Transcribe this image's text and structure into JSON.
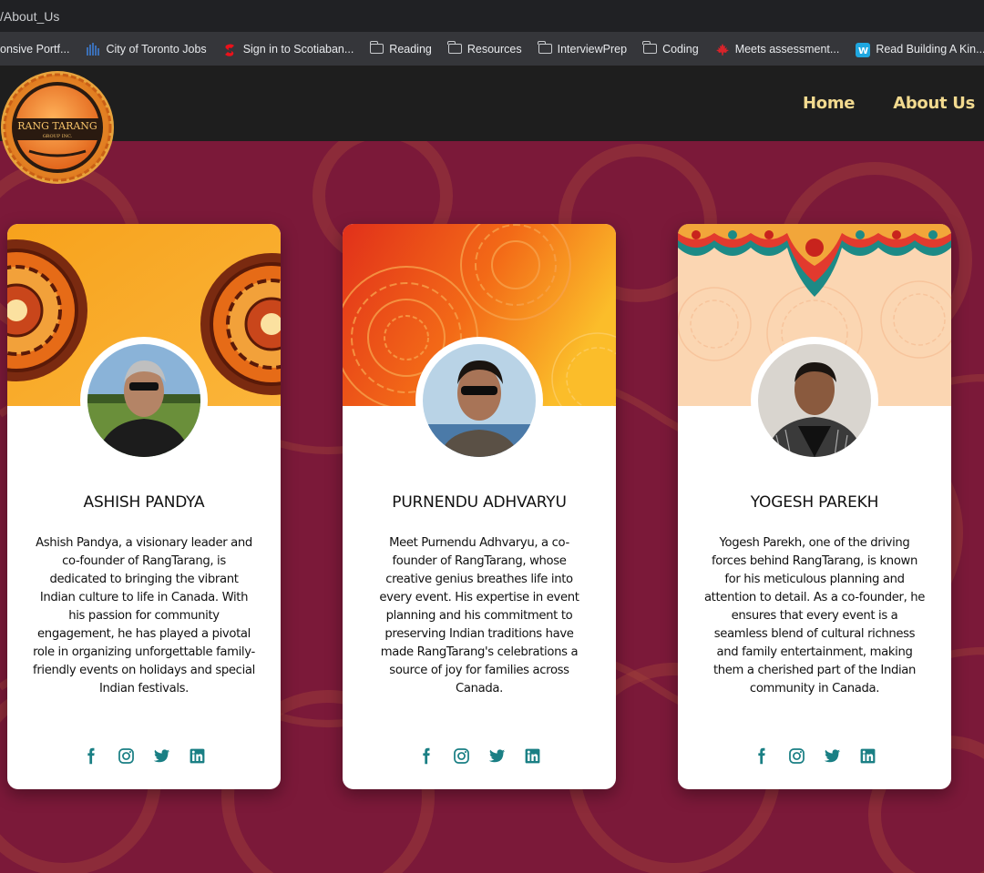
{
  "browser": {
    "url": "/About_Us",
    "bookmarks": [
      {
        "label": "onsive Portf...",
        "icon": "none"
      },
      {
        "label": "City of Toronto Jobs",
        "icon": "city-toronto-icon"
      },
      {
        "label": "Sign in to Scotiaban...",
        "icon": "scotiabank-icon"
      },
      {
        "label": "Reading",
        "icon": "folder-icon"
      },
      {
        "label": "Resources",
        "icon": "folder-icon"
      },
      {
        "label": "InterviewPrep",
        "icon": "folder-icon"
      },
      {
        "label": "Coding",
        "icon": "folder-icon"
      },
      {
        "label": "Meets assessment...",
        "icon": "maple-leaf-icon"
      },
      {
        "label": "Read Building A Kin...",
        "icon": "webtoon-icon"
      },
      {
        "label": "",
        "icon": "extension-icon"
      }
    ]
  },
  "header": {
    "logo": {
      "title": "RANG TARANG",
      "subtitle": "GROUP INC."
    },
    "nav": [
      {
        "label": "Home"
      },
      {
        "label": "About Us"
      }
    ]
  },
  "colors": {
    "accent_nav": "#f2da8f",
    "social_icon": "#1a7f84",
    "page_bg": "#7a1838",
    "header_bg": "#1e1e1e"
  },
  "team": [
    {
      "name": "ASHISH PANDYA",
      "bio": "Ashish Pandya, a visionary leader and co-founder of RangTarang, is dedicated to bringing the vibrant Indian culture to life in Canada. With his passion for community engagement, he has played a pivotal role in organizing unforgettable family-friendly events on holidays and special Indian festivals.",
      "socials": [
        "facebook-icon",
        "instagram-icon",
        "twitter-icon",
        "linkedin-icon"
      ]
    },
    {
      "name": "PURNENDU ADHVARYU",
      "bio": "Meet Purnendu Adhvaryu, a co-founder of RangTarang, whose creative genius breathes life into every event. His expertise in event planning and his commitment to preserving Indian traditions have made RangTarang's celebrations a source of joy for families across Canada.",
      "socials": [
        "facebook-icon",
        "instagram-icon",
        "twitter-icon",
        "linkedin-icon"
      ]
    },
    {
      "name": "YOGESH PAREKH",
      "bio": "Yogesh Parekh, one of the driving forces behind RangTarang, is known for his meticulous planning and attention to detail. As a co-founder, he ensures that every event is a seamless blend of cultural richness and family entertainment, making them a cherished part of the Indian community in Canada.",
      "socials": [
        "facebook-icon",
        "instagram-icon",
        "twitter-icon",
        "linkedin-icon"
      ]
    }
  ]
}
